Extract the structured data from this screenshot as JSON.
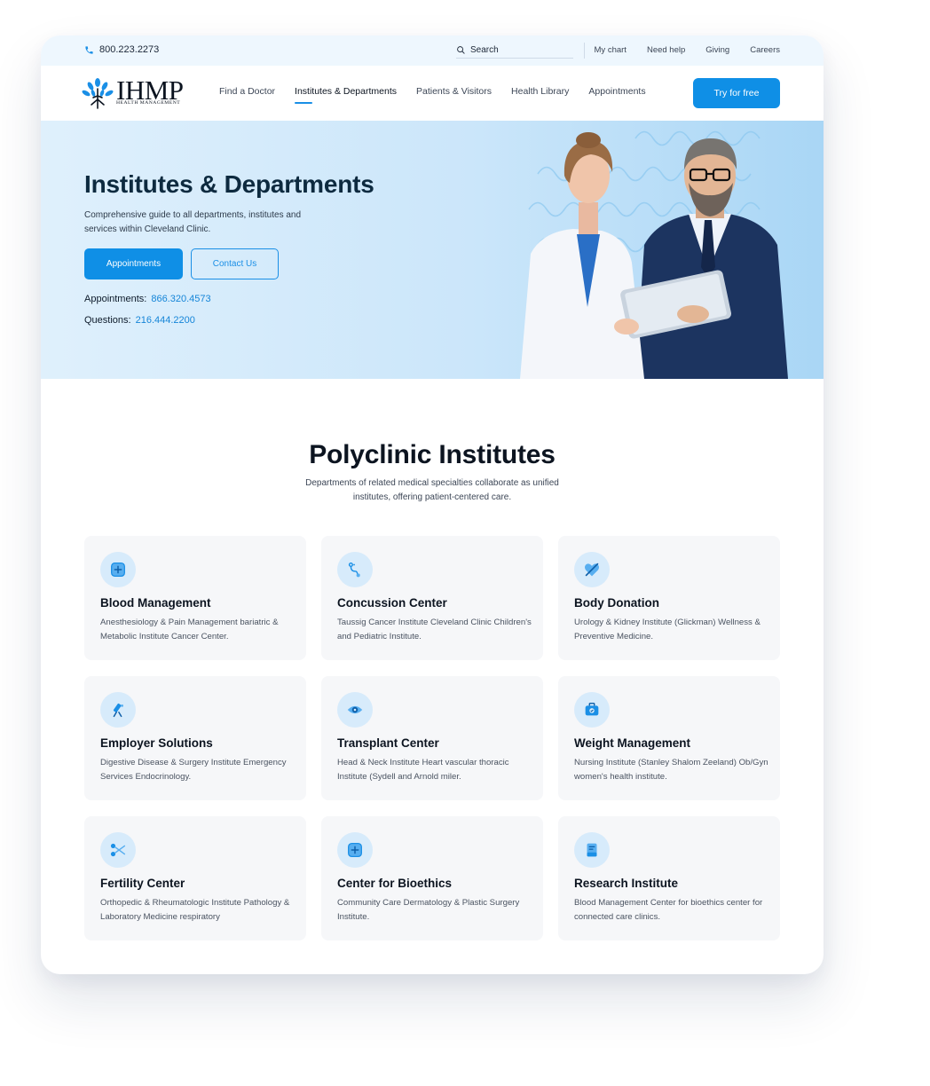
{
  "topbar": {
    "phone": "800.223.2273",
    "search_label": "Search",
    "links": [
      "My chart",
      "Need help",
      "Giving",
      "Careers"
    ]
  },
  "nav": {
    "logo_text": "IHMP",
    "logo_sub": "HEALTH MANAGEMENT",
    "items": [
      {
        "label": "Find a Doctor",
        "active": false
      },
      {
        "label": "Institutes & Departments",
        "active": true
      },
      {
        "label": "Patients & Visitors",
        "active": false
      },
      {
        "label": "Health Library",
        "active": false
      },
      {
        "label": "Appointments",
        "active": false
      }
    ],
    "cta": "Try for free"
  },
  "hero": {
    "title": "Institutes & Departments",
    "description": "Comprehensive guide to all departments, institutes and services within Cleveland Clinic.",
    "primary_button": "Appointments",
    "secondary_button": "Contact Us",
    "appointments_label": "Appointments:",
    "appointments_number": "866.320.4573",
    "questions_label": "Questions:",
    "questions_number": "216.444.2200"
  },
  "section": {
    "title": "Polyclinic Institutes",
    "description": "Departments of related medical specialties collaborate as unified institutes, offering patient-centered care."
  },
  "cards": [
    {
      "icon": "plus-box-icon",
      "title": "Blood Management",
      "description": "Anesthesiology & Pain Management bariatric & Metabolic Institute Cancer Center."
    },
    {
      "icon": "stethoscope-icon",
      "title": "Concussion Center",
      "description": "Taussig Cancer Institute Cleveland Clinic Children's and Pediatric Institute."
    },
    {
      "icon": "heart-off-icon",
      "title": "Body Donation",
      "description": "Urology & Kidney Institute (Glickman) Wellness & Preventive Medicine."
    },
    {
      "icon": "microscope-icon",
      "title": "Employer Solutions",
      "description": "Digestive Disease & Surgery Institute Emergency Services Endocrinology."
    },
    {
      "icon": "eye-icon",
      "title": "Transplant Center",
      "description": "Head & Neck Institute Heart vascular thoracic Institute (Sydell and Arnold miler."
    },
    {
      "icon": "medical-bag-icon",
      "title": "Weight Management",
      "description": "Nursing Institute (Stanley Shalom Zeeland) Ob/Gyn women's health institute."
    },
    {
      "icon": "scissors-icon",
      "title": "Fertility Center",
      "description": "Orthopedic & Rheumatologic Institute Pathology & Laboratory Medicine respiratory"
    },
    {
      "icon": "plus-box-icon",
      "title": "Center for Bioethics",
      "description": "Community Care Dermatology & Plastic Surgery Institute."
    },
    {
      "icon": "document-icon",
      "title": "Research Institute",
      "description": "Blood Management Center for bioethics center for connected care clinics."
    }
  ],
  "colors": {
    "accent": "#0f8fe6",
    "hero_bg": "#cbe6fa",
    "card_bg": "#f6f7f9"
  }
}
